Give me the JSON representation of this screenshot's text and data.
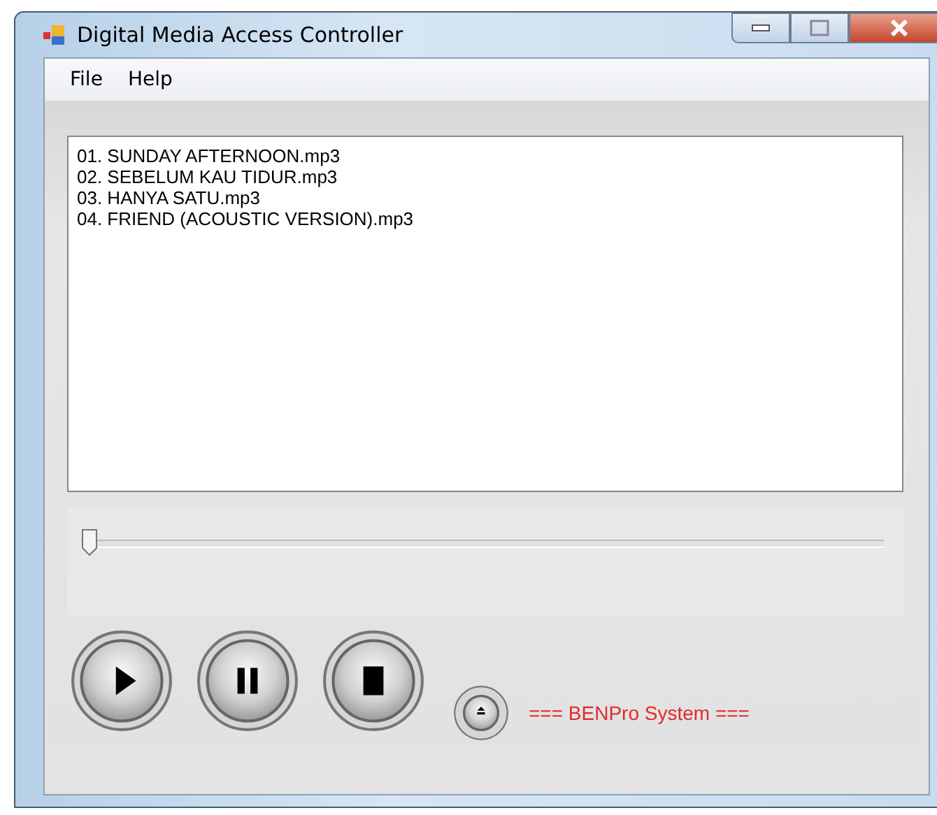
{
  "window": {
    "title": "Digital Media Access Controller"
  },
  "menu": [
    {
      "label": "File"
    },
    {
      "label": "Help"
    }
  ],
  "playlist": [
    "01. SUNDAY AFTERNOON.mp3",
    "02. SEBELUM KAU TIDUR.mp3",
    "03. HANYA SATU.mp3",
    "04. FRIEND (ACOUSTIC VERSION).mp3"
  ],
  "seek": {
    "level": 0
  },
  "controls": [
    {
      "kind": "play"
    },
    {
      "kind": "pause"
    },
    {
      "kind": "stop"
    },
    {
      "kind": "eject"
    }
  ],
  "footer_text": "=== BENPro System ==="
}
